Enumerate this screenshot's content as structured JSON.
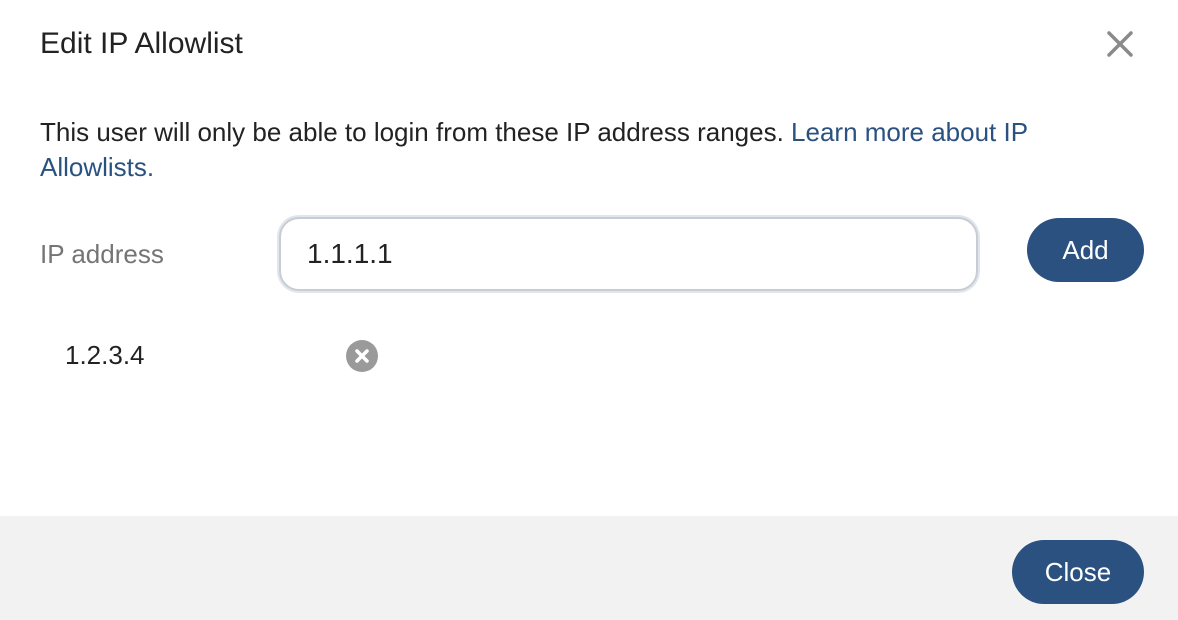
{
  "dialog": {
    "title": "Edit IP Allowlist",
    "close_icon": "close-icon",
    "description_text": "This user will only be able to login from these IP address ranges. ",
    "learn_more_link": "Learn more about IP Allowlists."
  },
  "form": {
    "ip_label": "IP address",
    "ip_input_value": "1.1.1.1",
    "add_label": "Add"
  },
  "allowlist": {
    "items": [
      {
        "ip": "1.2.3.4",
        "remove_icon": "remove-circle-x-icon"
      }
    ]
  },
  "footer": {
    "close_label": "Close"
  },
  "colors": {
    "accent": "#2a5180",
    "footer_bg": "#f2f2f2",
    "muted_text": "#757575",
    "icon_gray": "#9a9a9a"
  }
}
